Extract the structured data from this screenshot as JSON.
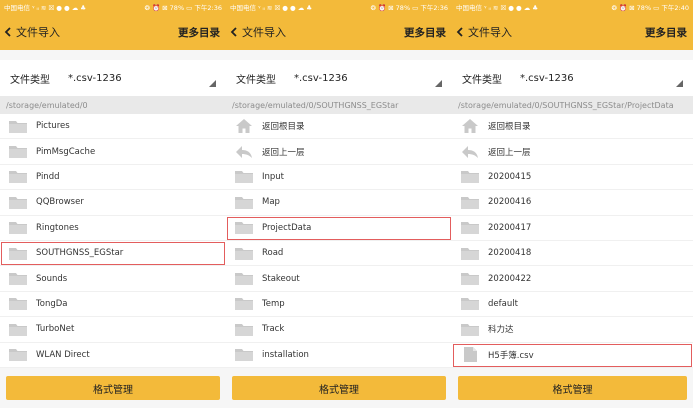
{
  "colors": {
    "accent": "#f3ba3a",
    "selection": "#e35d5d"
  },
  "panels": [
    {
      "status": {
        "left": "中国电信 ᵞ ᵢₗ ≋ ☒ ● ● ☁ ♣",
        "right": "❂ ⏰ ⊠ 78% ▭ 下午2:36"
      },
      "nav": {
        "back_label": "文件导入",
        "more_label": "更多目录"
      },
      "filetype": {
        "label": "文件类型",
        "value": "*.csv-1236"
      },
      "path": "/storage/emulated/0",
      "rows": [
        {
          "label": "Pictures",
          "icon": "folder-icon"
        },
        {
          "label": "PimMsgCache",
          "icon": "folder-icon"
        },
        {
          "label": "Pindd",
          "icon": "folder-icon"
        },
        {
          "label": "QQBrowser",
          "icon": "folder-icon"
        },
        {
          "label": "Ringtones",
          "icon": "folder-icon"
        },
        {
          "label": "SOUTHGNSS_EGStar",
          "icon": "folder-icon",
          "selected": true
        },
        {
          "label": "Sounds",
          "icon": "folder-icon"
        },
        {
          "label": "TongDa",
          "icon": "folder-icon"
        },
        {
          "label": "TurboNet",
          "icon": "folder-icon"
        },
        {
          "label": "WLAN Direct",
          "icon": "folder-icon"
        }
      ],
      "button": "格式管理"
    },
    {
      "status": {
        "left": "中国电信 ᵞ ᵢₗ ≋ ☒ ● ● ☁ ♣",
        "right": "❂ ⏰ ⊠ 78% ▭ 下午2:36"
      },
      "nav": {
        "back_label": "文件导入",
        "more_label": "更多目录"
      },
      "filetype": {
        "label": "文件类型",
        "value": "*.csv-1236"
      },
      "path": "/storage/emulated/0/SOUTHGNSS_EGStar",
      "rows": [
        {
          "label": "返回根目录",
          "icon": "home-icon"
        },
        {
          "label": "返回上一层",
          "icon": "back-arrow-icon"
        },
        {
          "label": "Input",
          "icon": "folder-icon"
        },
        {
          "label": "Map",
          "icon": "folder-icon"
        },
        {
          "label": "ProjectData",
          "icon": "folder-icon",
          "selected": true
        },
        {
          "label": "Road",
          "icon": "folder-icon"
        },
        {
          "label": "Stakeout",
          "icon": "folder-icon"
        },
        {
          "label": "Temp",
          "icon": "folder-icon"
        },
        {
          "label": "Track",
          "icon": "folder-icon"
        },
        {
          "label": "installation",
          "icon": "folder-icon"
        }
      ],
      "button": "格式管理"
    },
    {
      "status": {
        "left": "中国电信 ᵞ ᵢₗ ≋ ☒ ● ● ☁ ♣",
        "right": "❂ ⏰ ⊠ 78% ▭ 下午2:40"
      },
      "nav": {
        "back_label": "文件导入",
        "more_label": "更多目录"
      },
      "filetype": {
        "label": "文件类型",
        "value": "*.csv-1236"
      },
      "path": "/storage/emulated/0/SOUTHGNSS_EGStar/ProjectData",
      "rows": [
        {
          "label": "返回根目录",
          "icon": "home-icon"
        },
        {
          "label": "返回上一层",
          "icon": "back-arrow-icon"
        },
        {
          "label": "20200415",
          "icon": "folder-icon"
        },
        {
          "label": "20200416",
          "icon": "folder-icon"
        },
        {
          "label": "20200417",
          "icon": "folder-icon"
        },
        {
          "label": "20200418",
          "icon": "folder-icon"
        },
        {
          "label": "20200422",
          "icon": "folder-icon"
        },
        {
          "label": "default",
          "icon": "folder-icon"
        },
        {
          "label": "科力达",
          "icon": "folder-icon"
        },
        {
          "label": "H5手簿.csv",
          "icon": "file-icon",
          "selected": true
        }
      ],
      "button": "格式管理"
    }
  ]
}
